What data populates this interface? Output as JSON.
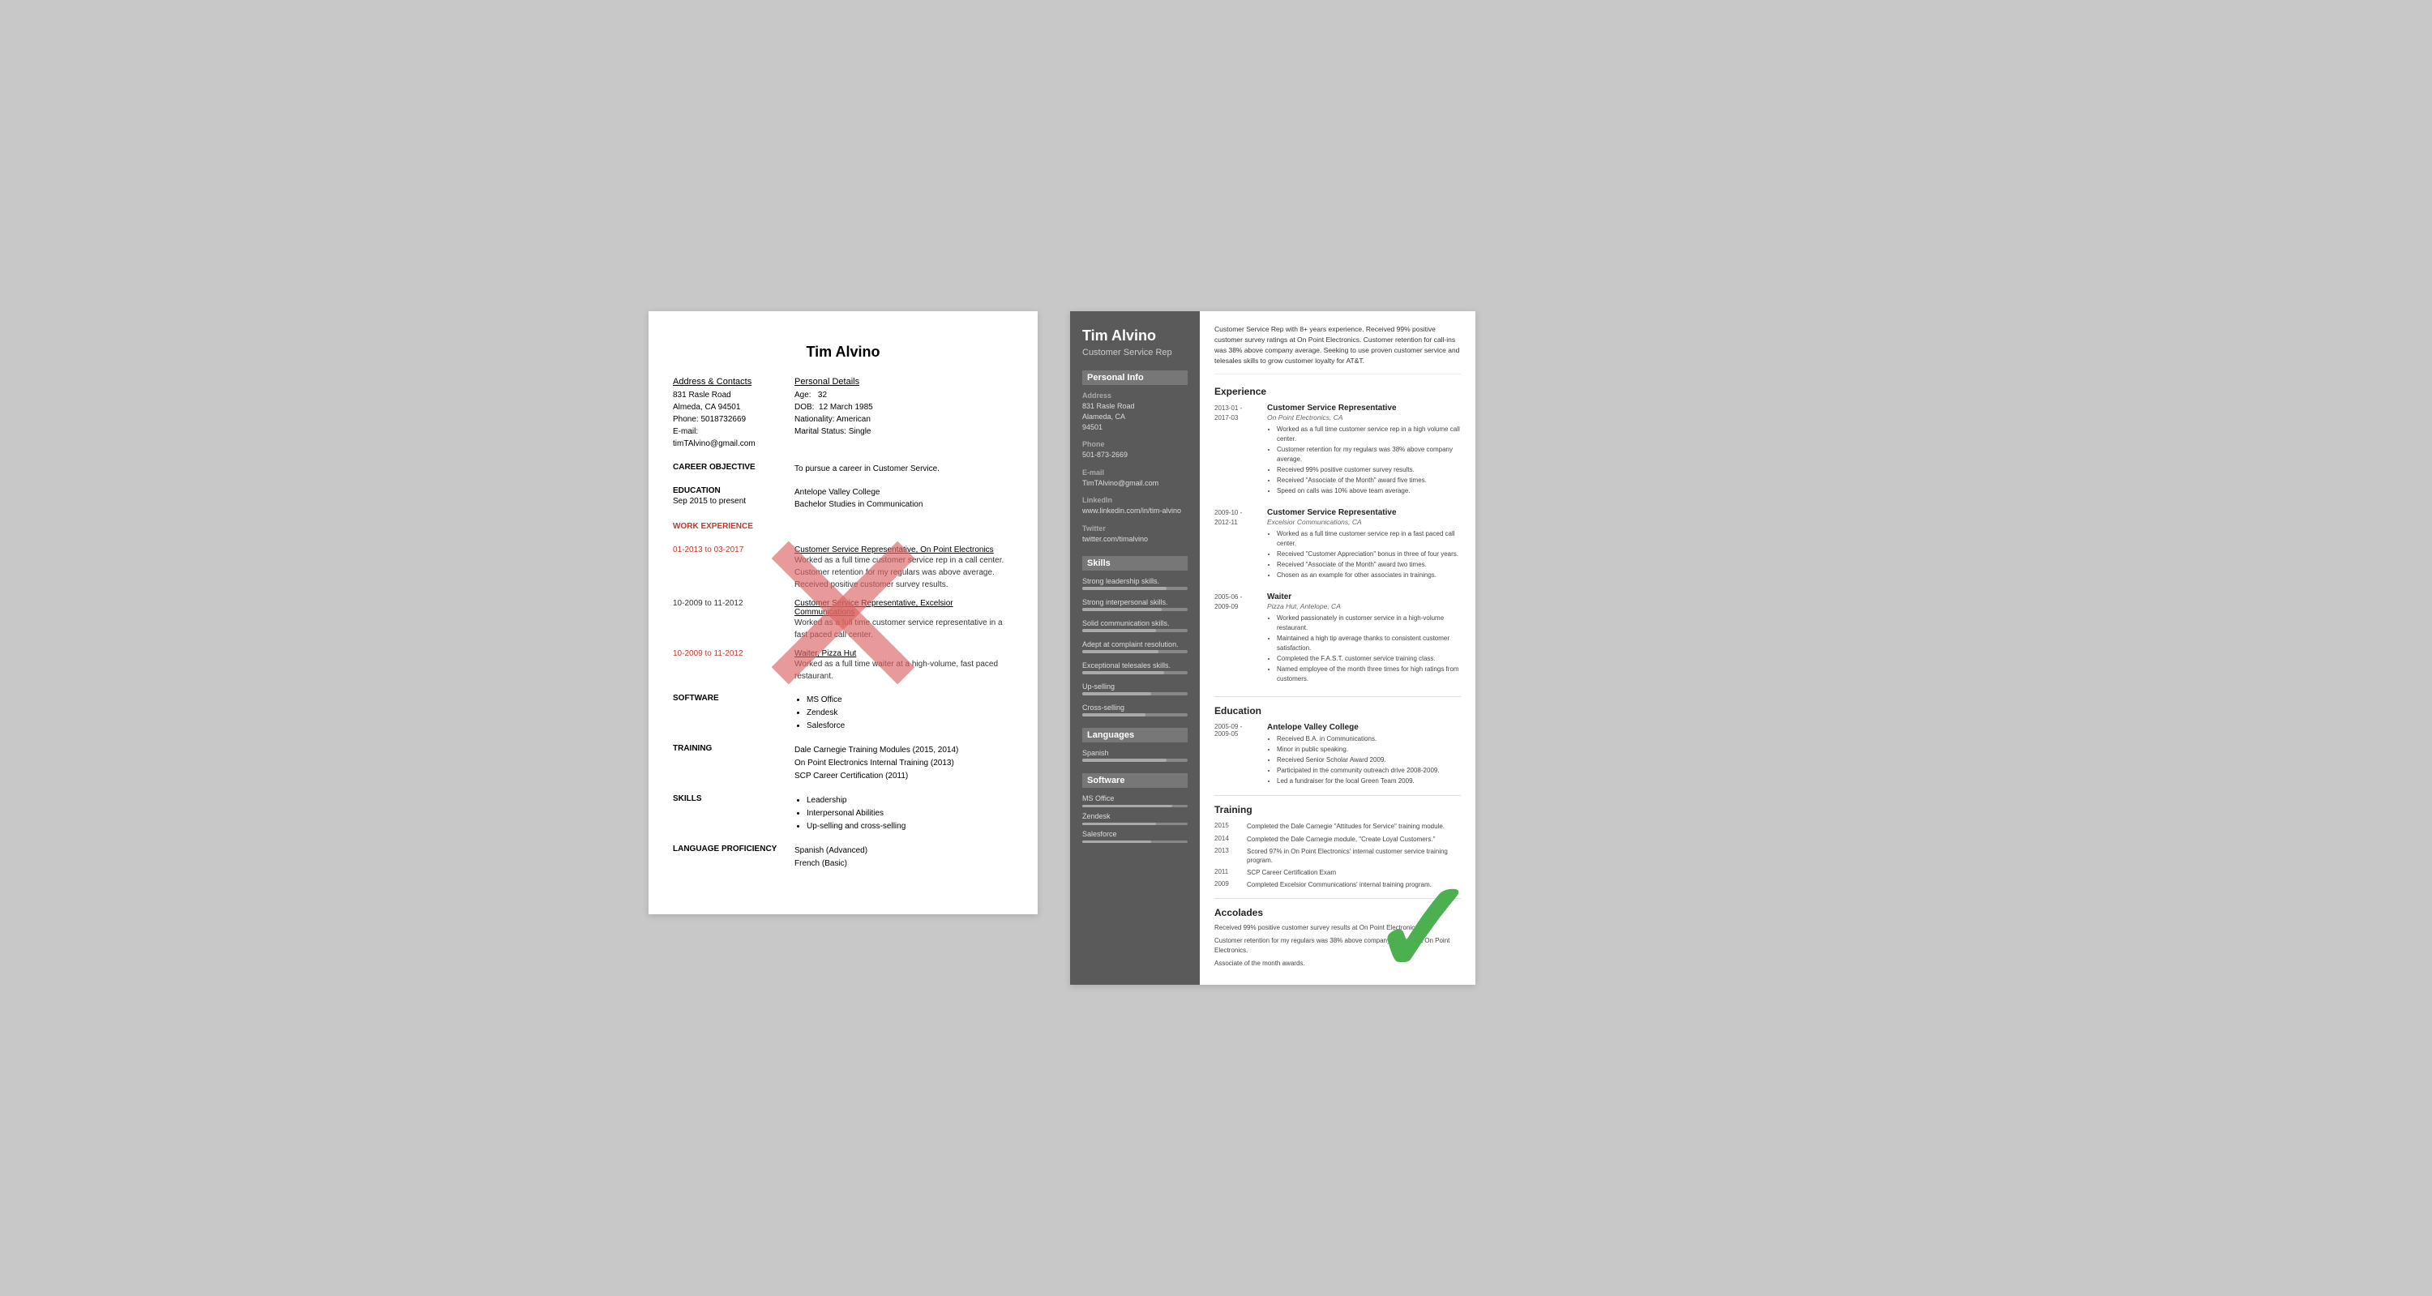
{
  "bad_resume": {
    "name": "Tim Alvino",
    "address_title": "Address & Contacts",
    "address_lines": [
      "831 Rasle Road",
      "Almeda, CA 94501",
      "Phone: 5018732669",
      "E-mail: timTAlvino@gmail.com"
    ],
    "personal_title": "Personal Details",
    "personal_lines": [
      "Age:   32",
      "DOB:  12 March 1985",
      "Nationality: American",
      "Marital Status: Single"
    ],
    "career_objective_label": "CAREER OBJECTIVE",
    "career_objective_text": "To pursue a career in Customer Service.",
    "education_label": "EDUCATION",
    "education_date": "Sep 2015 to present",
    "education_school": "Antelope Valley College",
    "education_degree": "Bachelor Studies in Communication",
    "work_experience_label": "WORK EXPERIENCE",
    "work_items": [
      {
        "dates": "01-2013 to 03-2017",
        "title": "Customer Service Representative, On Point Electronics",
        "desc": "Worked as a full time customer service rep in a call center. Customer retention for my regulars was above average. Received positive customer survey results."
      },
      {
        "dates": "10-2009 to 11-2012",
        "title": "Customer Service Representative, Excelsior Communications",
        "desc": "Worked as a full time customer service representative in a fast paced call center."
      },
      {
        "dates": "10-2009 to 11-2012",
        "title": "Waiter, Pizza Hut",
        "desc": "Worked as a full time waiter at a high-volume, fast paced restaurant."
      }
    ],
    "software_label": "SOFTWARE",
    "software_items": [
      "MS Office",
      "Zendesk",
      "Salesforce"
    ],
    "training_label": "TRAINING",
    "training_items": [
      "Dale Carnegie Training Modules (2015, 2014)",
      "On Point Electronics Internal Training (2013)",
      "SCP Career Certification (2011)"
    ],
    "skills_label": "SKILLS",
    "skills_items": [
      "Leadership",
      "Interpersonal Abilities",
      "Up-selling and cross-selling"
    ],
    "language_label": "LANGUAGE PROFICIENCY",
    "language_items": [
      "Spanish (Advanced)",
      "French (Basic)"
    ]
  },
  "good_resume": {
    "name": "Tim Alvino",
    "title": "Customer Service Rep",
    "summary": "Customer Service Rep with 8+ years experience. Received 99% positive customer survey ratings at On Point Electronics. Customer retention for call-ins was 38% above company average. Seeking to use proven customer service and telesales skills to grow customer loyalty for AT&T.",
    "sidebar": {
      "personal_info_title": "Personal Info",
      "address_label": "Address",
      "address_value": "831 Rasle Road\nAlameda, CA\n94501",
      "phone_label": "Phone",
      "phone_value": "501-873-2669",
      "email_label": "E-mail",
      "email_value": "TimTAlvino@gmail.com",
      "linkedin_label": "LinkedIn",
      "linkedin_value": "www.linkedin.com/in/tim-alvino",
      "twitter_label": "Twitter",
      "twitter_value": "twitter.com/timalvino",
      "skills_title": "Skills",
      "skills": [
        {
          "label": "Strong leadership skills.",
          "pct": 80
        },
        {
          "label": "Strong interpersonal skills.",
          "pct": 75
        },
        {
          "label": "Solid communication skills.",
          "pct": 70
        },
        {
          "label": "Adept at complaint resolution.",
          "pct": 72
        },
        {
          "label": "Exceptional telesales skills.",
          "pct": 78
        },
        {
          "label": "Up-selling",
          "pct": 65
        },
        {
          "label": "Cross-selling",
          "pct": 60
        }
      ],
      "languages_title": "Languages",
      "languages": [
        {
          "label": "Spanish",
          "pct": 80
        }
      ],
      "software_title": "Software",
      "software": [
        {
          "label": "MS Office",
          "pct": 85
        },
        {
          "label": "Zendesk",
          "pct": 70
        },
        {
          "label": "Salesforce",
          "pct": 65
        }
      ]
    },
    "experience_title": "Experience",
    "experience": [
      {
        "dates": "2013-01 -\n2017-03",
        "title": "Customer Service Representative",
        "company": "On Point Electronics, CA",
        "bullets": [
          "Worked as a full time customer service rep in a high volume call center.",
          "Customer retention for my regulars was 38% above company average.",
          "Received 99% positive customer survey results.",
          "Received \"Associate of the Month\" award five times.",
          "Speed on calls was 10% above team average."
        ]
      },
      {
        "dates": "2009-10 -\n2012-11",
        "title": "Customer Service Representative",
        "company": "Excelsior Communications, CA",
        "bullets": [
          "Worked as a full time customer service rep in a fast paced call center.",
          "Received \"Customer Appreciation\" bonus in three of four years.",
          "Received \"Associate of the Month\" award two times.",
          "Chosen as an example for other associates in trainings."
        ]
      },
      {
        "dates": "2005-06 -\n2009-09",
        "title": "Waiter",
        "company": "Pizza Hut, Antelope, CA",
        "bullets": [
          "Worked passionately in customer service in a high-volume restaurant.",
          "Maintained a high tip average thanks to consistent customer satisfaction.",
          "Completed the F.A.S.T. customer service training class.",
          "Named employee of the month three times for high ratings from customers."
        ]
      }
    ],
    "education_title": "Education",
    "education": [
      {
        "dates": "2005-09 -\n2009-05",
        "school": "Antelope Valley College",
        "bullets": [
          "Received B.A. in Communications.",
          "Minor in public speaking.",
          "Received Senior Scholar Award 2009.",
          "Participated in the community outreach drive 2008-2009.",
          "Led a fundraiser for the local Green Team 2009."
        ]
      }
    ],
    "training_title": "Training",
    "training": [
      {
        "year": "2015",
        "text": "Completed the Dale Carnegie \"Attitudes for Service\" training module."
      },
      {
        "year": "2014",
        "text": "Completed the Dale Carnegie module, \"Create Loyal Customers.\""
      },
      {
        "year": "2013",
        "text": "Scored 97% in On Point Electronics' internal customer service training program."
      },
      {
        "year": "2011",
        "text": "SCP Career Certification Exam"
      },
      {
        "year": "2009",
        "text": "Completed Excelsior Communications' internal training program."
      }
    ],
    "accolades_title": "Accolades",
    "accolades": [
      "Received 99% positive customer survey results at On Point Electronics.",
      "Customer retention for my regulars was 38% above company average at On Point Electronics.",
      "Associate of the month awards."
    ]
  }
}
